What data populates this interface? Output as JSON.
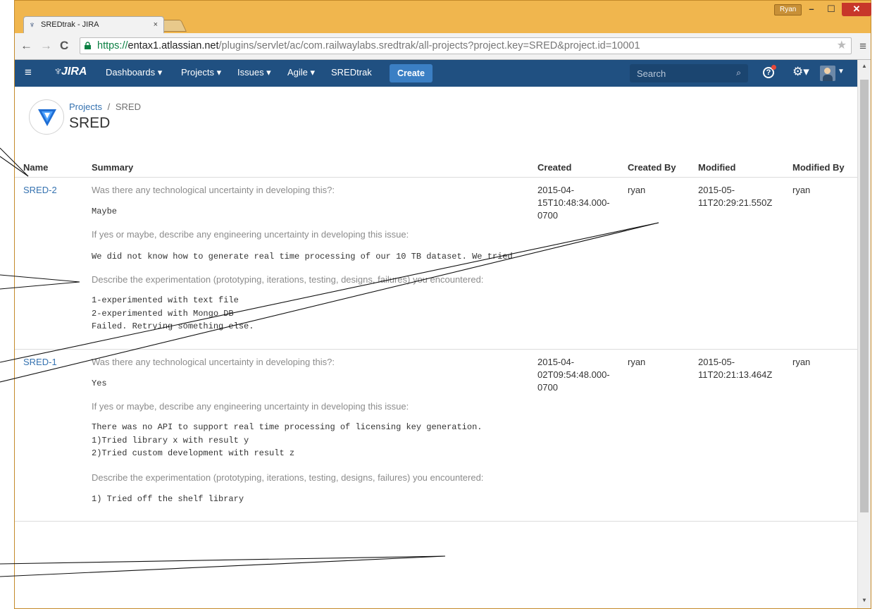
{
  "browser": {
    "tab_title": "SREDtrak - JIRA",
    "tab_close": "×",
    "user_badge": "Ryan",
    "url_scheme": "https://",
    "url_host": "entax1.atlassian.net",
    "url_path": "/plugins/servlet/ac/com.railwaylabs.sredtrak/all-projects?project.key=SRED&project.id=10001"
  },
  "header": {
    "logo": "JIRA",
    "nav": [
      "Dashboards ▾",
      "Projects ▾",
      "Issues ▾",
      "Agile ▾",
      "SREDtrak"
    ],
    "create": "Create",
    "search_placeholder": "Search"
  },
  "project": {
    "breadcrumb_link": "Projects",
    "breadcrumb_sep": "/",
    "breadcrumb_current": "SRED",
    "title": "SRED"
  },
  "table": {
    "columns": [
      "Name",
      "Summary",
      "Created",
      "Created By",
      "Modified",
      "Modified By"
    ],
    "rows": [
      {
        "name": "SRED-2",
        "q1": "Was there any technological uncertainty in developing this?:",
        "a1": "Maybe",
        "q2": "If yes or maybe, describe any engineering uncertainty in developing this issue:",
        "a2": "We did not know how to generate real time processing of our 10 TB dataset. We tried",
        "q3": "Describe the experimentation (prototyping, iterations, testing, designs, failures) you encountered:",
        "a3": "1-experimented with text file\n2-experimented with Mongo DB\nFailed. Retrying something else.",
        "created_1": "2015-04-",
        "created_2": "15T10:48:34.000-",
        "created_3": "0700",
        "created_by": "ryan",
        "modified_1": "2015-05-",
        "modified_2": "11T20:29:21.550Z",
        "modified_by": "ryan"
      },
      {
        "name": "SRED-1",
        "q1": "Was there any technological uncertainty in developing this?:",
        "a1": "Yes",
        "q2": "If yes or maybe, describe any engineering uncertainty in developing this issue:",
        "a2": "There was no API to support real time processing of licensing key generation.\n1)Tried library x with result y\n2)Tried custom development with result z",
        "q3": "Describe the experimentation (prototyping, iterations, testing, designs, failures) you encountered:",
        "a3": "1) Tried off the shelf library",
        "created_1": "2015-04-",
        "created_2": "02T09:54:48.000-",
        "created_3": "0700",
        "created_by": "ryan",
        "modified_1": "2015-05-",
        "modified_2": "11T20:21:13.464Z",
        "modified_by": "ryan"
      }
    ]
  },
  "colors": {
    "window_frame": "#f0b64e",
    "jira_header": "#205081",
    "create_button": "#3b7fc4",
    "link": "#3572b0"
  },
  "icons": [
    "jira-favicon",
    "lock-icon",
    "star-icon",
    "menu-icon",
    "hamburger-icon",
    "search-icon",
    "help-icon",
    "gear-icon",
    "avatar"
  ]
}
